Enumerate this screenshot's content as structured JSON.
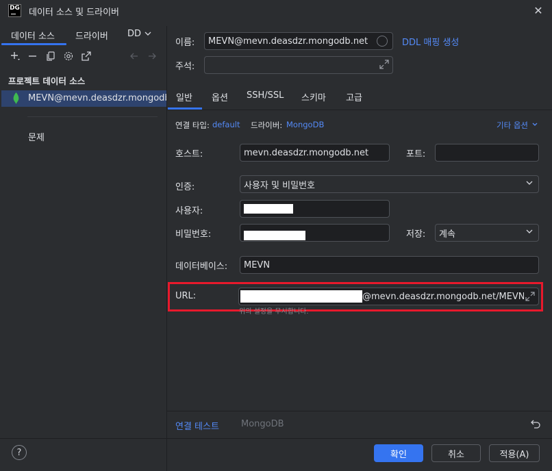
{
  "window": {
    "title": "데이터 소스 및 드라이버",
    "app_icon_text": "DG"
  },
  "left": {
    "tabs": [
      "데이터 소스",
      "드라이버",
      "DD"
    ],
    "section_label": "프로젝트 데이터 소스",
    "data_source": "MEVN@mevn.deasdzr.mongodb.net",
    "problems": "문제"
  },
  "form": {
    "name_label": "이름:",
    "name_value": "MEVN@mevn.deasdzr.mongodb.net",
    "ddl_link": "DDL 매핑 생성",
    "comment_label": "주석:",
    "tabs": [
      "일반",
      "옵션",
      "SSH/SSL",
      "스키마",
      "고급"
    ],
    "conn_type_label": "연결 타입:",
    "conn_type_value": "default",
    "driver_label": "드라이버:",
    "driver_value": "MongoDB",
    "more_options": "기타 옵션",
    "host_label": "호스트:",
    "host_value": "mevn.deasdzr.mongodb.net",
    "port_label": "포트:",
    "port_value": "",
    "auth_label": "인증:",
    "auth_value": "사용자 및 비밀번호",
    "user_label": "사용자:",
    "password_label": "비밀번호:",
    "save_label": "저장:",
    "save_value": "계속",
    "database_label": "데이터베이스:",
    "database_value": "MEVN",
    "url_label": "URL:",
    "url_value": "@mevn.deasdzr.mongodb.net/MEVN",
    "url_hint": "위의 설정을 무시합니다."
  },
  "bottom": {
    "test_link": "연결 테스트",
    "driver_name": "MongoDB"
  },
  "footer": {
    "ok": "확인",
    "cancel": "취소",
    "apply": "적용(A)",
    "help": "?"
  },
  "colors": {
    "accent": "#3574f0",
    "highlight": "#e8192c",
    "link": "#548af7",
    "leaf": "#3fb950"
  }
}
